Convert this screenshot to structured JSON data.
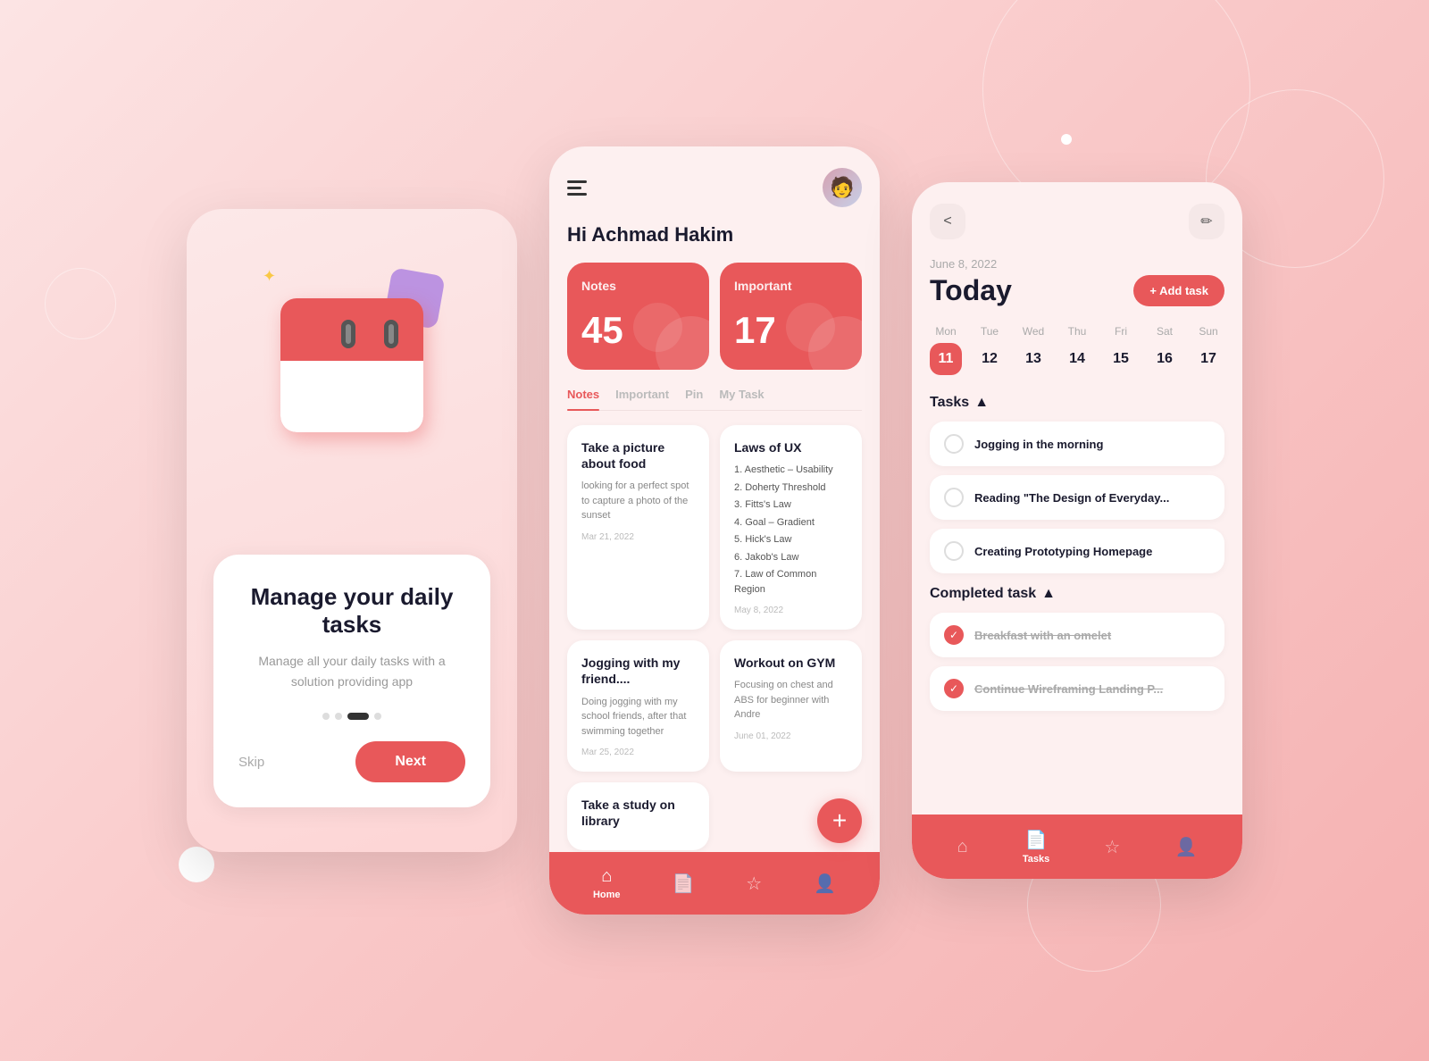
{
  "screen1": {
    "title": "Manage your\ndaily tasks",
    "subtitle": "Manage all your daily tasks\nwith a solution providing app",
    "skip_label": "Skip",
    "next_label": "Next",
    "dots": [
      false,
      false,
      true,
      false
    ]
  },
  "screen2": {
    "greeting": "Hi Achmad Hakim",
    "notes_card": {
      "label": "Notes",
      "count": "45"
    },
    "important_card": {
      "label": "Important",
      "count": "17"
    },
    "tabs": [
      "Notes",
      "Important",
      "Pin",
      "My Task"
    ],
    "active_tab": 0,
    "notes": [
      {
        "title": "Take a picture about food",
        "body": "looking for a perfect spot to capture a photo of the sunset",
        "date": "Mar 21, 2022"
      },
      {
        "title": "Laws of UX",
        "list": [
          "1. Aesthetic – Usability",
          "2. Doherty Threshold",
          "3. Fitts's Law",
          "4. Goal – Gradient",
          "5. Hick's Law",
          "6. Jakob's Law",
          "7. Law of Common Region"
        ],
        "date": "May 8, 2022"
      },
      {
        "title": "Jogging with my friend....",
        "body": "Doing jogging with my school friends, after that swimming together",
        "date": "Mar 25, 2022"
      },
      {
        "title": "Workout on GYM",
        "body": "Focusing on chest and ABS for beginner with Andre",
        "date": "June 01, 2022"
      },
      {
        "title": "Take a study on library",
        "body": "",
        "date": ""
      }
    ],
    "bottom_nav": [
      {
        "label": "Home",
        "active": true
      },
      {
        "label": "",
        "active": false
      },
      {
        "label": "",
        "active": false
      },
      {
        "label": "",
        "active": false
      }
    ]
  },
  "screen3": {
    "date_label": "June 8, 2022",
    "today_title": "Today",
    "add_task_label": "+ Add task",
    "week": [
      {
        "day": "Mon",
        "num": "11",
        "selected": true
      },
      {
        "day": "Tue",
        "num": "12",
        "selected": false
      },
      {
        "day": "Wed",
        "num": "13",
        "selected": false
      },
      {
        "day": "Thu",
        "num": "14",
        "selected": false
      },
      {
        "day": "Fri",
        "num": "15",
        "selected": false
      },
      {
        "day": "Sat",
        "num": "16",
        "selected": false
      },
      {
        "day": "Sun",
        "num": "17",
        "selected": false
      }
    ],
    "tasks_section": "Tasks",
    "tasks": [
      {
        "text": "Jogging in the morning",
        "done": false
      },
      {
        "text": "Reading \"The Design of Everyday...",
        "done": false
      },
      {
        "text": "Creating Prototyping Homepage",
        "done": false
      }
    ],
    "completed_section": "Completed task",
    "completed_tasks": [
      {
        "text": "Breakfast with an omelet",
        "done": true
      },
      {
        "text": "Continue Wireframing Landing P...",
        "done": true
      }
    ],
    "bottom_nav": [
      {
        "label": "",
        "active": false
      },
      {
        "label": "Tasks",
        "active": true
      },
      {
        "label": "",
        "active": false
      },
      {
        "label": "",
        "active": false
      }
    ]
  }
}
